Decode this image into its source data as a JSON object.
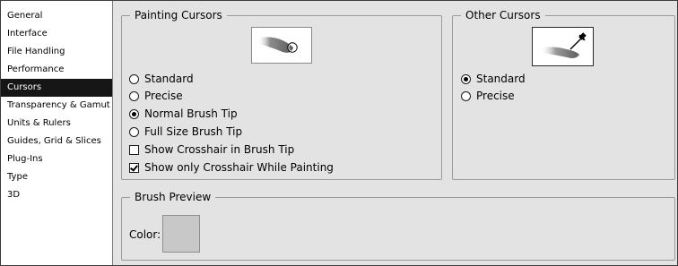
{
  "sidebar": {
    "items": [
      {
        "label": "General",
        "selected": false
      },
      {
        "label": "Interface",
        "selected": false
      },
      {
        "label": "File Handling",
        "selected": false
      },
      {
        "label": "Performance",
        "selected": false
      },
      {
        "label": "Cursors",
        "selected": true
      },
      {
        "label": "Transparency & Gamut",
        "selected": false
      },
      {
        "label": "Units & Rulers",
        "selected": false
      },
      {
        "label": "Guides, Grid & Slices",
        "selected": false
      },
      {
        "label": "Plug-Ins",
        "selected": false
      },
      {
        "label": "Type",
        "selected": false
      },
      {
        "label": "3D",
        "selected": false
      }
    ]
  },
  "painting_cursors": {
    "title": "Painting Cursors",
    "preview_icon": "brush-stroke-preview",
    "options": [
      {
        "label": "Standard",
        "checked": false
      },
      {
        "label": "Precise",
        "checked": false
      },
      {
        "label": "Normal Brush Tip",
        "checked": true
      },
      {
        "label": "Full Size Brush Tip",
        "checked": false
      }
    ],
    "checkboxes": [
      {
        "label": "Show Crosshair in Brush Tip",
        "checked": false
      },
      {
        "label": "Show only Crosshair While Painting",
        "checked": true
      }
    ]
  },
  "other_cursors": {
    "title": "Other Cursors",
    "preview_icon": "eyedropper-preview",
    "options": [
      {
        "label": "Standard",
        "checked": true
      },
      {
        "label": "Precise",
        "checked": false
      }
    ]
  },
  "brush_preview": {
    "title": "Brush Preview",
    "color_label": "Color:",
    "color_value": "#c8c8c8"
  }
}
